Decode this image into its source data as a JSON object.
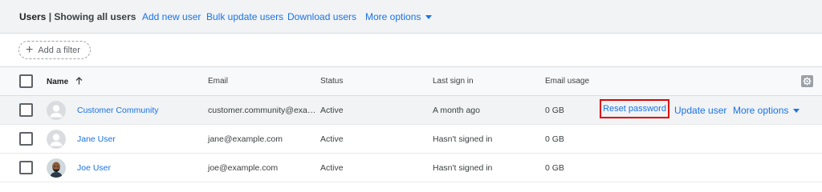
{
  "toolbar": {
    "title": "Users",
    "subtitle": "| Showing all users",
    "add_user": "Add new user",
    "bulk_update": "Bulk update users",
    "download": "Download users",
    "more_options": "More options"
  },
  "filter": {
    "add_filter": "Add a filter"
  },
  "table": {
    "columns": {
      "name": "Name",
      "email": "Email",
      "status": "Status",
      "last_sign_in": "Last sign in",
      "email_usage": "Email usage"
    },
    "rows": [
      {
        "name": "Customer Community",
        "email": "customer.community@exa…",
        "status": "Active",
        "last_sign_in": "A month ago",
        "email_usage": "0 GB",
        "avatar": "default-avatar-icon"
      },
      {
        "name": "Jane User",
        "email": "jane@example.com",
        "status": "Active",
        "last_sign_in": "Hasn't signed in",
        "email_usage": "0 GB",
        "avatar": "default-avatar-icon"
      },
      {
        "name": "Joe User",
        "email": "joe@example.com",
        "status": "Active",
        "last_sign_in": "Hasn't signed in",
        "email_usage": "0 GB",
        "avatar": "photo-avatar"
      }
    ],
    "row_actions": {
      "reset_password": "Reset password",
      "update_user": "Update user",
      "more_options": "More options"
    }
  },
  "colors": {
    "link": "#1a73e8",
    "highlight_border": "#e00000",
    "toolbar_bg": "#f1f3f4"
  }
}
